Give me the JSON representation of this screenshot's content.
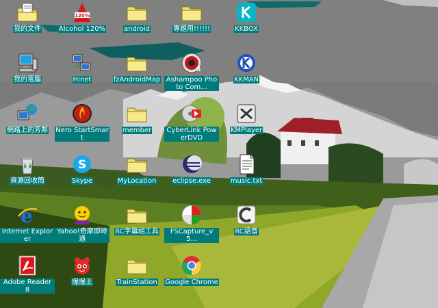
{
  "desktop": {
    "icons": [
      {
        "label": "我的文件",
        "icon": "my-documents-icon"
      },
      {
        "label": "Alcohol 120%",
        "icon": "alcohol-icon"
      },
      {
        "label": "android",
        "icon": "folder-icon"
      },
      {
        "label": "專題用!!!!!!",
        "icon": "folder-icon"
      },
      {
        "label": "KKBOX",
        "icon": "kkbox-icon"
      },
      {
        "label": "我的電腦",
        "icon": "my-computer-icon"
      },
      {
        "label": "Hinet",
        "icon": "network-computer-icon"
      },
      {
        "label": "fzAndroidMap",
        "icon": "folder-icon"
      },
      {
        "label": "Ashampoo Photo Com...",
        "icon": "ashampoo-icon"
      },
      {
        "label": "KKMAN",
        "icon": "kkman-icon"
      },
      {
        "label": "網路上的芳鄰",
        "icon": "network-globe-icon"
      },
      {
        "label": "Nero StartSmart",
        "icon": "nero-icon"
      },
      {
        "label": "member",
        "icon": "folder-icon"
      },
      {
        "label": "CyberLink PowerDVD",
        "icon": "powerdvd-icon"
      },
      {
        "label": "KMPlayer",
        "icon": "kmplayer-icon"
      },
      {
        "label": "資源回收筒",
        "icon": "recycle-bin-icon"
      },
      {
        "label": "Skype",
        "icon": "skype-icon"
      },
      {
        "label": "MyLocation",
        "icon": "folder-icon"
      },
      {
        "label": "eclipse.exe",
        "icon": "eclipse-icon"
      },
      {
        "label": "music.txt",
        "icon": "text-file-icon"
      },
      {
        "label": "Internet Explorer",
        "icon": "internet-explorer-icon"
      },
      {
        "label": "Yahoo!奇摩即時通",
        "icon": "yahoo-messenger-icon"
      },
      {
        "label": "RC字幕組工具",
        "icon": "folder-icon"
      },
      {
        "label": "FSCapture_v5...",
        "icon": "fscapture-icon"
      },
      {
        "label": "RC語音",
        "icon": "rc-voice-icon"
      },
      {
        "label": "Adobe Reader 8",
        "icon": "adobe-reader-icon"
      },
      {
        "label": "爆爆王",
        "icon": "game-character-icon"
      },
      {
        "label": "TrainStation",
        "icon": "folder-icon"
      },
      {
        "label": "Google Chrome",
        "icon": "chrome-icon"
      }
    ]
  },
  "colors": {
    "label_bg": "#007b7b",
    "label_text": "#ffffff",
    "folder": "#f0e070"
  }
}
